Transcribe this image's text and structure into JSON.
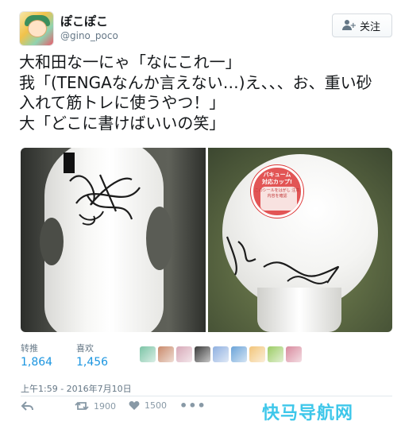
{
  "user": {
    "name": "ぽこぽこ",
    "handle": "@gino_poco"
  },
  "follow_button": {
    "label": "关注",
    "icon": "follow-user-icon"
  },
  "tweet": {
    "lines": [
      "大和田な一にゃ「なにこれ一」",
      "我「(TENGAなんか言えない…)え、、、お、重い砂",
      "入れて筋トレに使うやつ！」",
      "大「どこに書けばいいの笑」"
    ]
  },
  "photos": {
    "seal_line1": "バキューム",
    "seal_line2": "対応カップ!",
    "seal_small": "このシールをはがし 注意内容を確認"
  },
  "stats": {
    "retweets_label": "转推",
    "retweets_value": "1,864",
    "likes_label": "喜欢",
    "likes_value": "1,456",
    "liker_colors": [
      "#7cc4a6",
      "#c98a6b",
      "#d7a9b8",
      "#3a3a3a",
      "#8fb0e0",
      "#6aa3d8",
      "#f2c57a",
      "#9ccc65",
      "#d88a9e"
    ]
  },
  "timestamp": "上午1:59 - 2016年7月10日",
  "actions": {
    "reply_icon": "reply-icon",
    "retweet_icon": "retweet-icon",
    "retweet_count": "1900",
    "like_icon": "heart-icon",
    "like_count": "1500",
    "more_icon": "more-dots-icon",
    "more_label": "•••"
  },
  "watermark": "快马导航网",
  "colors": {
    "link_blue": "#1b95e0",
    "muted": "#657786",
    "watermark": "#3ec7ea"
  }
}
